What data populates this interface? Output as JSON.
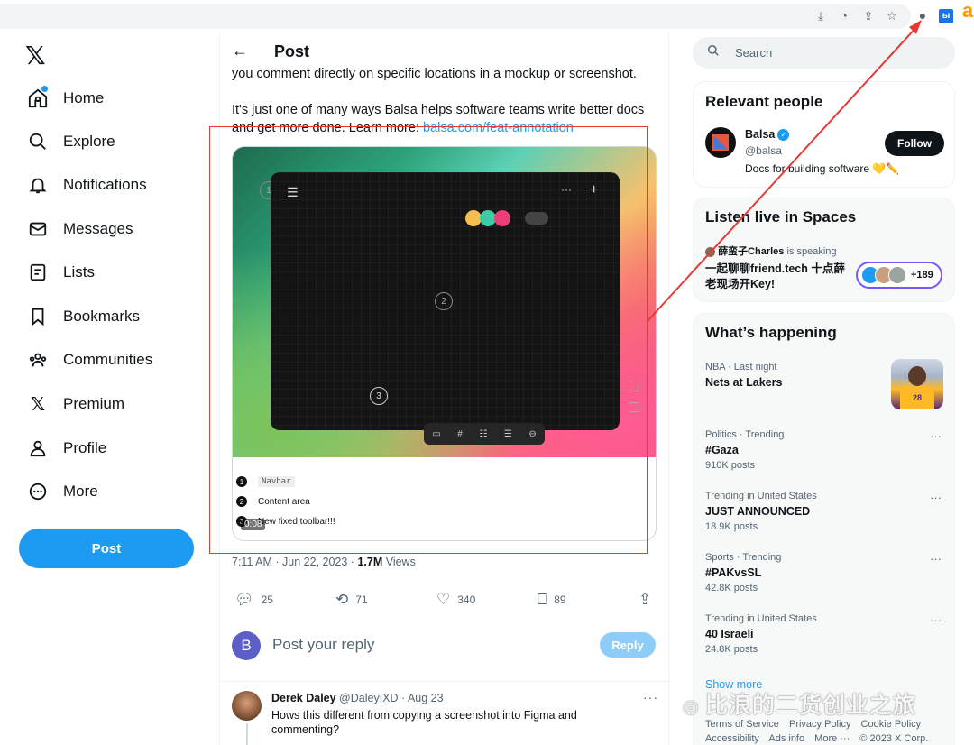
{
  "browser": {
    "icons": [
      "download-icon",
      "performance-icon",
      "share-icon",
      "bookmark-star-icon",
      "extension-icon",
      "translate-extension-icon",
      "amazon-extension-icon"
    ],
    "ext_label": "ы",
    "amazon_label": "a"
  },
  "nav": {
    "items": [
      {
        "label": "Home",
        "icon": "home-icon"
      },
      {
        "label": "Explore",
        "icon": "search-icon"
      },
      {
        "label": "Notifications",
        "icon": "bell-icon"
      },
      {
        "label": "Messages",
        "icon": "mail-icon"
      },
      {
        "label": "Lists",
        "icon": "list-icon"
      },
      {
        "label": "Bookmarks",
        "icon": "bookmark-icon"
      },
      {
        "label": "Communities",
        "icon": "communities-icon"
      },
      {
        "label": "Premium",
        "icon": "x-icon"
      },
      {
        "label": "Profile",
        "icon": "profile-icon"
      },
      {
        "label": "More",
        "icon": "more-icon"
      }
    ],
    "post_button": "Post"
  },
  "post": {
    "header_title": "Post",
    "text_line1": "you comment directly on specific locations in a mockup or screenshot.",
    "text_para2": "It's just one of many ways Balsa helps software teams write better docs and get more done. Learn more: ",
    "link": "balsa.com/feat-annotation",
    "media": {
      "badges": [
        "1",
        "2",
        "3"
      ],
      "legend": [
        {
          "num": "1",
          "text": "Navbar"
        },
        {
          "num": "2",
          "text": "Content area"
        },
        {
          "num": "3",
          "text": "New fixed toolbar!!!"
        }
      ],
      "timer": "0:08",
      "circle_colors": [
        "#f6bd4f",
        "#3fc9a5",
        "#ec3f7a"
      ]
    },
    "time": "7:11 AM · Jun 22, 2023 · ",
    "views_count": "1.7M",
    "views_label": " Views",
    "actions": {
      "replies": "25",
      "reposts": "71",
      "likes": "340",
      "bookmarks": "89"
    },
    "reply_placeholder": "Post your reply",
    "reply_button": "Reply",
    "reply_avatar_letter": "B"
  },
  "comment": {
    "name": "Derek Daley",
    "meta": " @DaleyIXD · Aug 23",
    "text": "Hows this different from copying a screenshot into Figma and commenting?",
    "more": "···"
  },
  "sidebar": {
    "search_placeholder": "Search",
    "relevant": {
      "title": "Relevant people",
      "name": "Balsa",
      "handle": "@balsa",
      "bio": "Docs for building software 💛✏️",
      "follow": "Follow"
    },
    "spaces": {
      "title": "Listen live in Spaces",
      "speaker_name": "薛蛮子Charles",
      "speaker_suffix": " is speaking",
      "space_title": "一起聊聊friend.tech 十点薛老现场开Key!",
      "listeners": "+189"
    },
    "happening": {
      "title": "What’s happening",
      "trends": [
        {
          "context": "NBA · Last night",
          "title": "Nets at Lakers",
          "posts": ""
        },
        {
          "context": "Politics · Trending",
          "title": "#Gaza",
          "posts": "910K posts"
        },
        {
          "context": "Trending in United States",
          "title": "JUST ANNOUNCED",
          "posts": "18.9K posts"
        },
        {
          "context": "Sports · Trending",
          "title": "#PAKvsSL",
          "posts": "42.8K posts"
        },
        {
          "context": "Trending in United States",
          "title": "40 Israeli",
          "posts": "24.8K posts"
        }
      ],
      "jersey_number": "28",
      "show_more": "Show more"
    },
    "footer": {
      "row1": [
        "Terms of Service",
        "Privacy Policy",
        "Cookie Policy"
      ],
      "row2": [
        "Accessibility",
        "Ads info",
        "More ···",
        "© 2023 X Corp."
      ]
    }
  },
  "watermark": "比浪的二货创业之旅",
  "colors": {
    "accent": "#1d9bf0",
    "annotation_red": "#e53935",
    "spaces_purple": "#7856ff"
  }
}
